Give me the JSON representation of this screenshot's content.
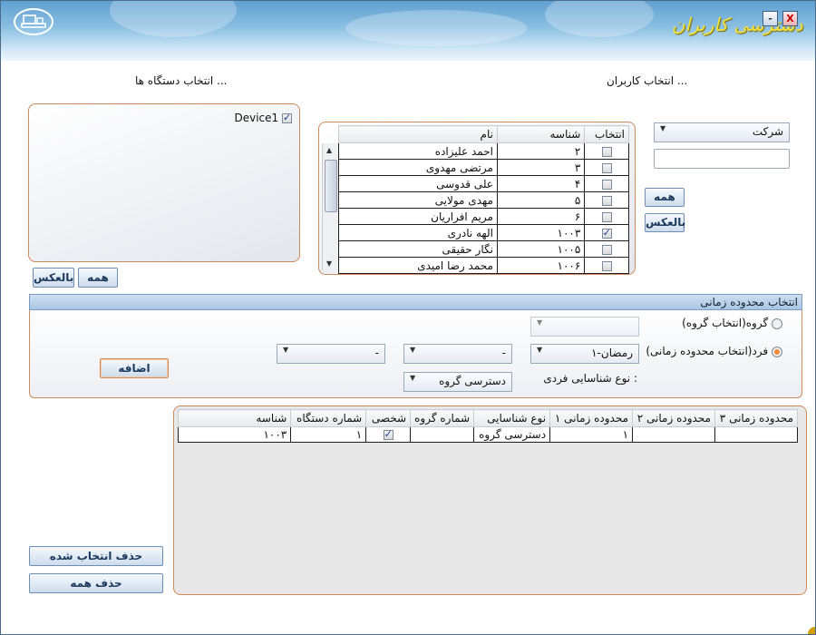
{
  "window": {
    "title": "دسترسی کاربران",
    "minimize": "-",
    "close": "X"
  },
  "devices": {
    "heading": "انتخاب دستگاه ها ...",
    "items": [
      {
        "label": "Device1",
        "checked": true
      }
    ],
    "btn_invert": "بالعکس",
    "btn_all": "همه"
  },
  "users": {
    "heading": "انتخاب کاربران ...",
    "company_select": "شرکت",
    "company_filter_value": "",
    "btn_all": "همه",
    "btn_invert": "بالعکس",
    "columns": {
      "select": "انتخاب",
      "id": "شناسه",
      "name": "نام"
    },
    "rows": [
      {
        "checked": false,
        "id": "۲",
        "name": "احمد علیزاده"
      },
      {
        "checked": false,
        "id": "۳",
        "name": "مرتضی مهدوی"
      },
      {
        "checked": false,
        "id": "۴",
        "name": "علی قدوسی"
      },
      {
        "checked": false,
        "id": "۵",
        "name": "مهدی مولایی"
      },
      {
        "checked": false,
        "id": "۶",
        "name": "مریم افراریان"
      },
      {
        "checked": true,
        "id": "۱۰۰۳",
        "name": "الهه نادری"
      },
      {
        "checked": false,
        "id": "۱۰۰۵",
        "name": "نگار حقیقی"
      },
      {
        "checked": false,
        "id": "۱۰۰۶",
        "name": "محمد رضا امیدی"
      }
    ]
  },
  "time_range": {
    "heading": "انتخاب محدوده زمانی",
    "radio_group": "گروه(انتخاب گروه)",
    "radio_individual": "فرد(انتخاب محدوده زمانی)",
    "group_select": "",
    "range1_select": "۱-رمضان",
    "range2_select": "-",
    "range3_select": "-",
    "auth_type_label": "نوع شناسایی فردی :",
    "auth_type_select": "دسترسی گروه",
    "btn_add": "اضافه"
  },
  "results": {
    "columns": [
      "شناسه",
      "شماره دستگاه",
      "شخصی",
      "شماره گروه",
      "نوع شناسایی",
      "محدوده زمانی ۱",
      "محدوده زمانی ۲",
      "محدوده زمانی ۳"
    ],
    "rows": [
      {
        "id": "۱۰۰۳",
        "device": "۱",
        "personal": true,
        "group": "",
        "auth": "دسترسی گروه",
        "r1": "۱",
        "r2": "",
        "r3": ""
      }
    ],
    "btn_delete_selected": "حذف انتخاب شده",
    "btn_delete_all": "حذف همه"
  },
  "colors": {
    "accent": "#d18a5a",
    "title_text": "#f2e13a",
    "section_bar": "#a9c5e3"
  }
}
